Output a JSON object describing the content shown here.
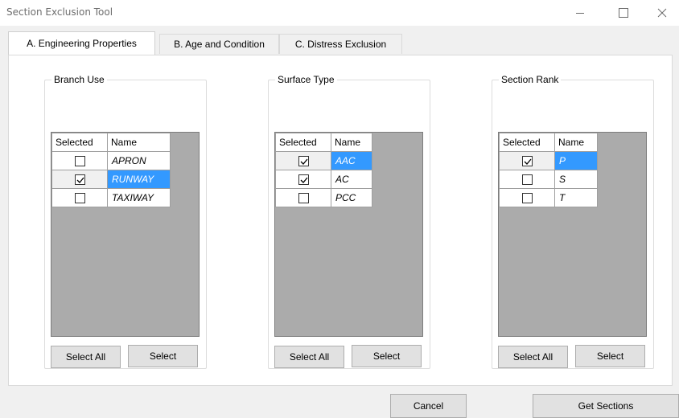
{
  "window": {
    "title": "Section Exclusion Tool"
  },
  "tabs": [
    {
      "label": "A. Engineering Properties",
      "active": true
    },
    {
      "label": "B. Age and Condition",
      "active": false
    },
    {
      "label": "C. Distress Exclusion",
      "active": false
    }
  ],
  "groups": [
    {
      "title": "Branch Use",
      "columns": [
        "Selected",
        "Name"
      ],
      "rows": [
        {
          "checked": false,
          "name": "APRON",
          "highlighted": false
        },
        {
          "checked": true,
          "name": "RUNWAY",
          "highlighted": true
        },
        {
          "checked": false,
          "name": "TAXIWAY",
          "highlighted": false
        }
      ],
      "select_all_label": "Select All",
      "select_label": "Select"
    },
    {
      "title": "Surface Type",
      "columns": [
        "Selected",
        "Name"
      ],
      "rows": [
        {
          "checked": true,
          "name": "AAC",
          "highlighted": true
        },
        {
          "checked": true,
          "name": "AC",
          "highlighted": false
        },
        {
          "checked": false,
          "name": "PCC",
          "highlighted": false
        }
      ],
      "select_all_label": "Select All",
      "select_label": "Select"
    },
    {
      "title": "Section Rank",
      "columns": [
        "Selected",
        "Name"
      ],
      "rows": [
        {
          "checked": true,
          "name": "P",
          "highlighted": true
        },
        {
          "checked": false,
          "name": "S",
          "highlighted": false
        },
        {
          "checked": false,
          "name": "T",
          "highlighted": false
        }
      ],
      "select_all_label": "Select All",
      "select_label": "Select"
    }
  ],
  "footer": {
    "cancel_label": "Cancel",
    "get_sections_label": "Get Sections"
  },
  "colors": {
    "selection": "#3399ff",
    "grid_background": "#ababab",
    "window_background": "#f0f0f0"
  },
  "icons": {
    "minimize": "minimize-icon",
    "maximize": "maximize-icon",
    "close": "close-icon",
    "checkbox": "checkmark-icon"
  }
}
